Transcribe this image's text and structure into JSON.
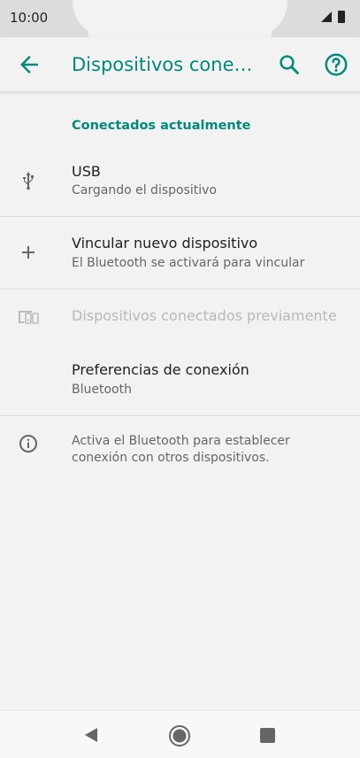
{
  "status": {
    "time": "10:00"
  },
  "app_bar": {
    "title": "Dispositivos conectados"
  },
  "section": {
    "header": "Conectados actualmente"
  },
  "items": [
    {
      "title": "USB",
      "subtitle": "Cargando el dispositivo",
      "icon": "usb-icon"
    },
    {
      "title": "Vincular nuevo dispositivo",
      "subtitle": "El Bluetooth se activará para vincular",
      "icon": "plus-icon"
    },
    {
      "title": "Dispositivos conectados previamente",
      "icon": "devices-icon"
    },
    {
      "title": "Preferencias de conexión",
      "subtitle": "Bluetooth"
    }
  ],
  "info": {
    "text": "Activa el Bluetooth para establecer conexión con otros dispositivos.",
    "icon": "info-icon"
  },
  "colors": {
    "accent": "#00897b",
    "background": "#f2f2f2",
    "text": "#212121",
    "secondary": "#666666"
  }
}
